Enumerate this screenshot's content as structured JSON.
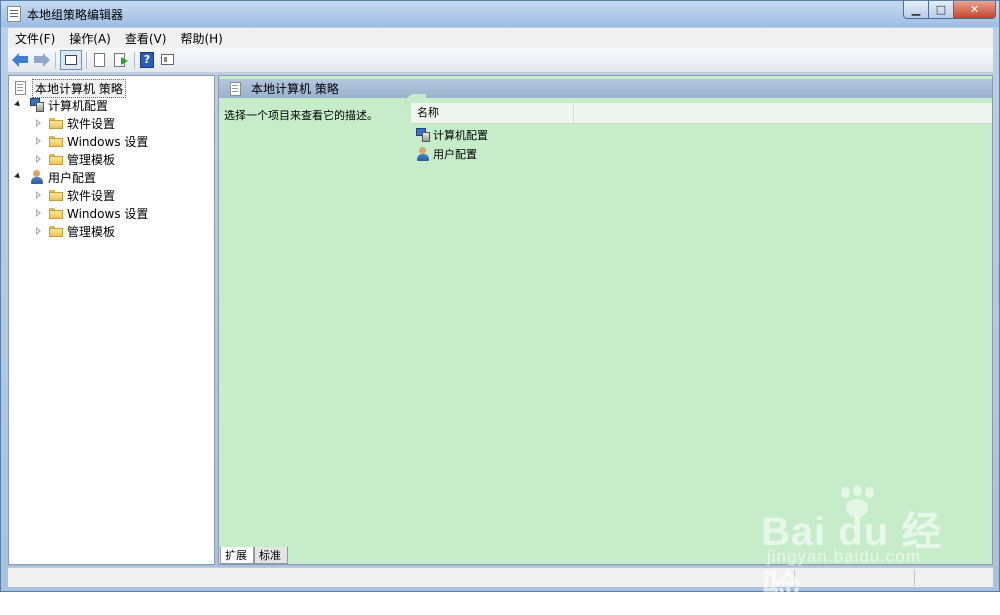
{
  "window": {
    "title": "本地组策略编辑器"
  },
  "menu": [
    {
      "label": "文件(F)"
    },
    {
      "label": "操作(A)"
    },
    {
      "label": "查看(V)"
    },
    {
      "label": "帮助(H)"
    }
  ],
  "toolbar": {
    "help_glyph": "?",
    "icons": [
      "back-arrow-icon",
      "forward-arrow-icon",
      "show-hide-tree-icon",
      "properties-icon",
      "export-list-icon",
      "help-icon",
      "view-icon"
    ]
  },
  "tree": [
    {
      "label": "本地计算机 策略",
      "level": 0,
      "expander": "none",
      "icon": "doc",
      "selected": true
    },
    {
      "label": "计算机配置",
      "level": 1,
      "expander": "open",
      "icon": "computer"
    },
    {
      "label": "软件设置",
      "level": 2,
      "expander": "closed",
      "icon": "folder"
    },
    {
      "label": "Windows 设置",
      "level": 2,
      "expander": "closed",
      "icon": "folder"
    },
    {
      "label": "管理模板",
      "level": 2,
      "expander": "closed",
      "icon": "folder"
    },
    {
      "label": "用户配置",
      "level": 1,
      "expander": "open",
      "icon": "user"
    },
    {
      "label": "软件设置",
      "level": 2,
      "expander": "closed",
      "icon": "folder"
    },
    {
      "label": "Windows 设置",
      "level": 2,
      "expander": "closed",
      "icon": "folder"
    },
    {
      "label": "管理模板",
      "level": 2,
      "expander": "closed",
      "icon": "folder"
    }
  ],
  "content": {
    "header": "本地计算机 策略",
    "description": "选择一个项目来查看它的描述。",
    "column_name": "名称",
    "items": [
      {
        "label": "计算机配置",
        "icon": "computer"
      },
      {
        "label": "用户配置",
        "icon": "user"
      }
    ],
    "tabs": [
      {
        "label": "扩展",
        "active": true
      },
      {
        "label": "标准",
        "active": false
      }
    ]
  },
  "watermark": {
    "main": "Bai du 经验",
    "sub": "jingyan.baidu.com"
  },
  "colors": {
    "content_bg": "#c6ecc9",
    "header_bg": "#9bb3cf",
    "titlebar": "#b9d1ea",
    "close_button": "#c7432b"
  }
}
